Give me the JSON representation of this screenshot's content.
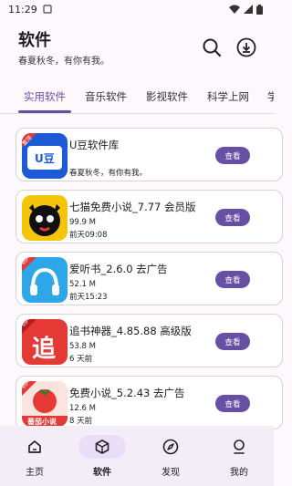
{
  "status": {
    "time": "11:29"
  },
  "header": {
    "title": "软件",
    "subtitle": "春夏秋冬，有你有我。"
  },
  "tabs": [
    {
      "label": "实用软件"
    },
    {
      "label": "音乐软件"
    },
    {
      "label": "影视软件"
    },
    {
      "label": "科学上网"
    },
    {
      "label": "学"
    }
  ],
  "apps": [
    {
      "name": "U豆软件库",
      "line2": "",
      "line3": "春夏秋冬，有你有我。",
      "button": "查看",
      "icon_badge": "置顶",
      "icon_text": "U豆"
    },
    {
      "name": "七猫免费小说_7.77 会员版",
      "line2": "99.9 M",
      "line3": "前天09:08",
      "button": "查看"
    },
    {
      "name": "爱听书_2.6.0 去广告",
      "line2": "52.1 M",
      "line3": "前天15:23",
      "button": "查看",
      "icon_badge": "VIP"
    },
    {
      "name": "追书神器_4.85.88 高级版",
      "line2": "53.8 M",
      "line3": "6 天前",
      "button": "查看",
      "icon_badge": "VIP",
      "icon_text": "追"
    },
    {
      "name": "免费小说_5.2.43 去广告",
      "line2": "12.6 M",
      "line3": "8 天前",
      "button": "查看",
      "icon_badge": "VIP",
      "icon_text": "番茄小说"
    }
  ],
  "nav": [
    {
      "label": "主页"
    },
    {
      "label": "软件"
    },
    {
      "label": "发现"
    },
    {
      "label": "我的"
    }
  ],
  "colors": {
    "accent": "#6750a4",
    "nav_bg": "#f3edf7",
    "nav_active": "#e8def8"
  }
}
